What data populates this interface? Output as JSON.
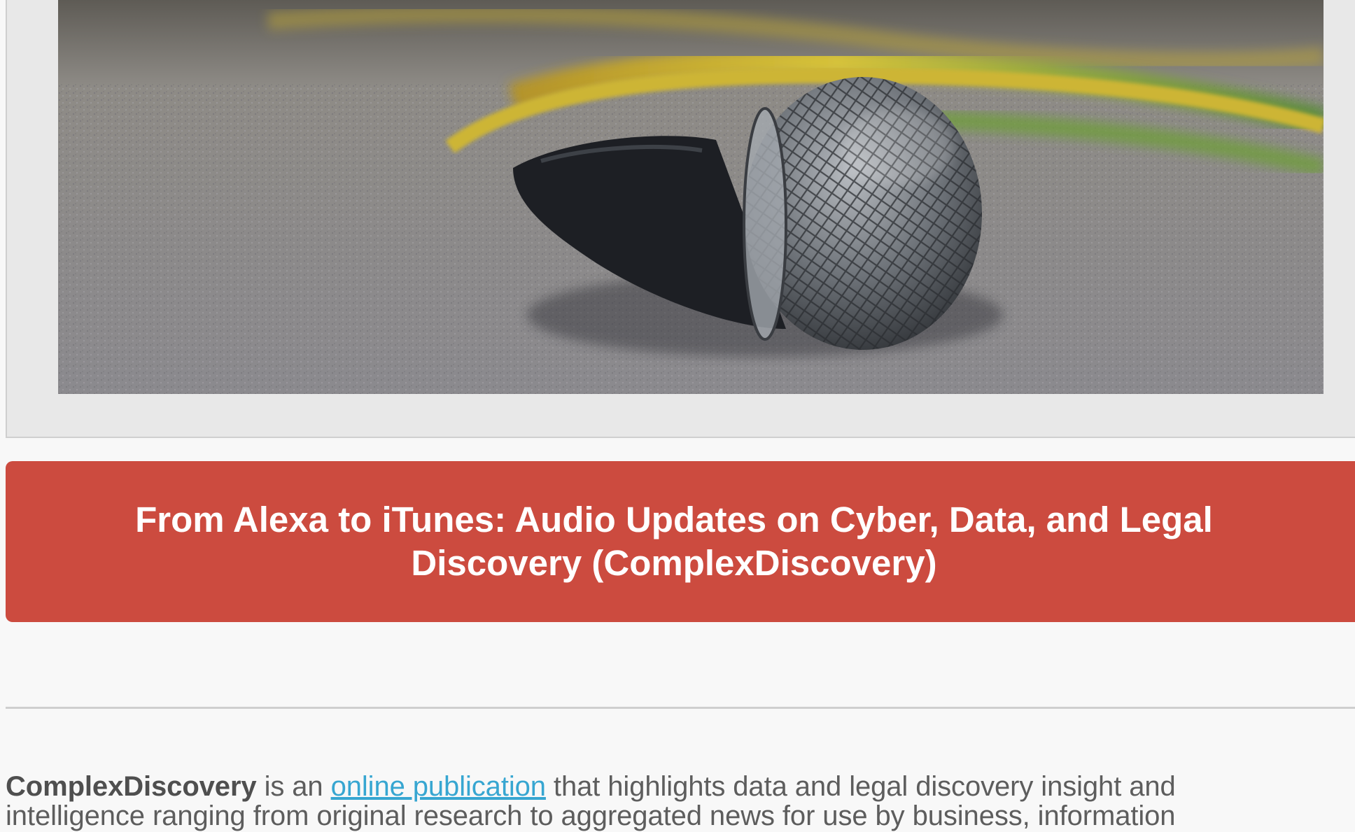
{
  "hero": {
    "image_alt": "Microphone lying on carpet"
  },
  "cta": {
    "title": "From Alexa to iTunes: Audio Updates on Cyber, Data, and Legal Discovery (ComplexDiscovery)"
  },
  "about": {
    "brand": "ComplexDiscovery",
    "text_before_link": " is an ",
    "link_text": "online publication",
    "text_after_link": " that highlights data and legal discovery insight and intelligence ranging from original research to aggregated news for use by business, information"
  },
  "colors": {
    "cta_background": "#cc4b3f",
    "link": "#37a6d1",
    "body_text": "#5d5d5d"
  }
}
